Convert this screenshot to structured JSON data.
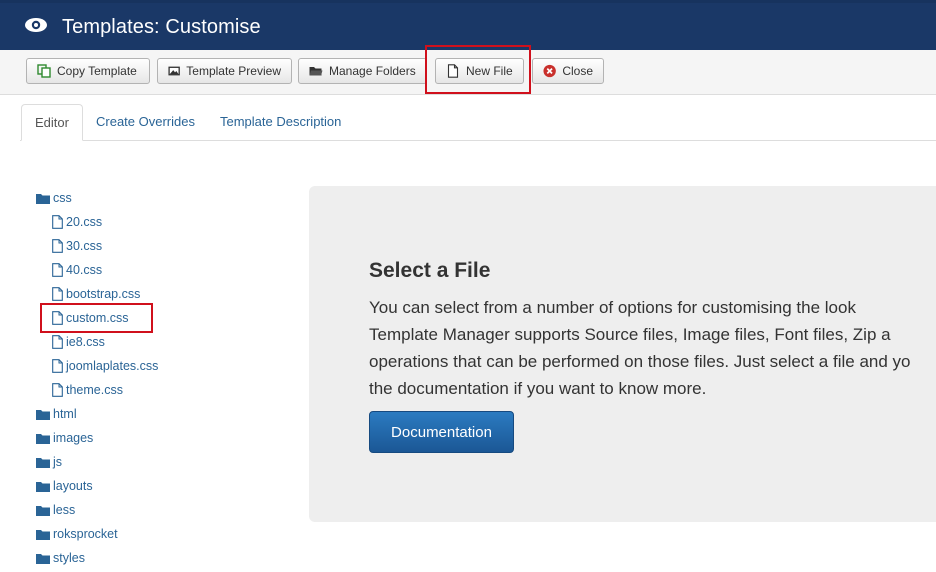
{
  "header": {
    "icon": "eye-icon",
    "title": "Templates: Customise"
  },
  "toolbar": {
    "copy_template": "Copy Template",
    "template_preview": "Template Preview",
    "manage_folders": "Manage Folders",
    "new_file": "New File",
    "close": "Close"
  },
  "tabs": [
    "Editor",
    "Create Overrides",
    "Template Description"
  ],
  "tree": {
    "css_folder": "css",
    "css_files": [
      "20.css",
      "30.css",
      "40.css",
      "bootstrap.css",
      "custom.css",
      "ie8.css",
      "joomlaplates.css",
      "theme.css"
    ],
    "folders": [
      "html",
      "images",
      "js",
      "layouts",
      "less",
      "roksprocket",
      "styles"
    ]
  },
  "panel": {
    "heading": "Select a File",
    "line1": "You can select from a number of options for customising the look",
    "line2": "Template Manager supports Source files, Image files, Font files, Zip a",
    "line3": "operations that can be performed on those files. Just select a file and yo",
    "line4": "the documentation if you want to know more.",
    "button": "Documentation"
  },
  "colors": {
    "header_bg": "#1a3867",
    "link": "#2a6496",
    "highlight": "#d0101c",
    "doc_button": "#1b5795"
  }
}
